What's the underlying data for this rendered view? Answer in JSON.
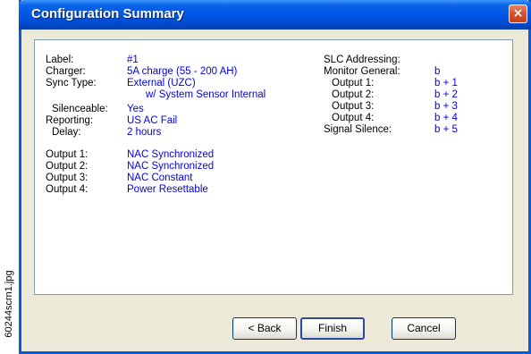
{
  "side_caption": "60244scrn1.jpg",
  "window": {
    "title": "Configuration Summary",
    "close_glyph": "×"
  },
  "left_items": [
    {
      "label": "Label:",
      "value": "#1"
    },
    {
      "label": "Charger:",
      "value": "5A charge (55 - 200 AH)"
    },
    {
      "label": "Sync Type:",
      "value": "External (UZC)"
    },
    {
      "label": "",
      "value": "w/ System Sensor Internal"
    },
    {
      "label": "Silenceable:",
      "value": "Yes"
    },
    {
      "label": "Reporting:",
      "value": "US AC Fail"
    },
    {
      "label": "Delay:",
      "value": "2 hours"
    }
  ],
  "output_items": [
    {
      "label": "Output 1:",
      "value": "NAC Synchronized"
    },
    {
      "label": "Output 2:",
      "value": "NAC Synchronized"
    },
    {
      "label": "Output 3:",
      "value": "NAC Constant"
    },
    {
      "label": "Output 4:",
      "value": "Power Resettable"
    }
  ],
  "right_items": [
    {
      "label": "SLC Addressing:",
      "value": ""
    },
    {
      "label": "Monitor General:",
      "value": "b"
    },
    {
      "label": "Output 1:",
      "value": "b + 1"
    },
    {
      "label": "Output 2:",
      "value": "b + 2"
    },
    {
      "label": "Output 3:",
      "value": "b + 3"
    },
    {
      "label": "Output 4:",
      "value": "b + 4"
    },
    {
      "label": "Signal Silence:",
      "value": "b + 5"
    }
  ],
  "buttons": {
    "back": "< Back",
    "finish": "Finish",
    "cancel": "Cancel"
  },
  "colors": {
    "title_bar": "#0055e5",
    "dialog_bg": "#ece9d8",
    "value_text": "#0000e0"
  }
}
